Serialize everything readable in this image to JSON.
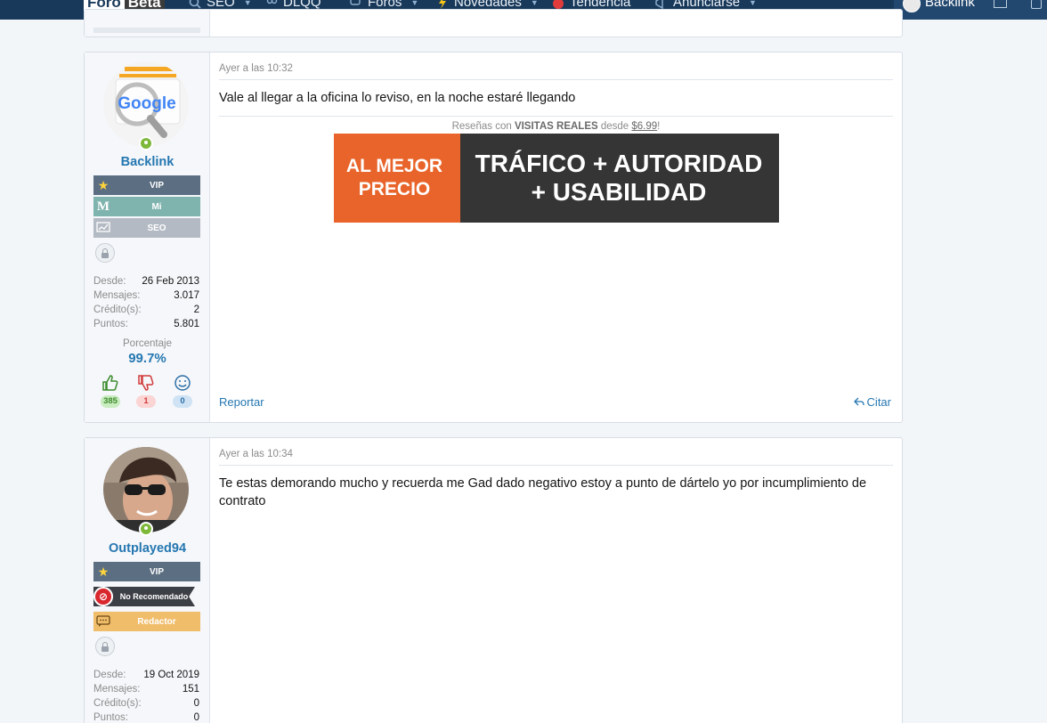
{
  "topbar": {
    "logo_part1": "Foro",
    "logo_part2": "Beta",
    "nav": [
      "SEO",
      "DLQQ",
      "Foros",
      "Novedades",
      "Tendencia",
      "Anunciarse"
    ],
    "user": "Backlink"
  },
  "posts": [
    {
      "date": "Ayer a las 10:32",
      "user": {
        "name": "Backlink",
        "avatar_text": "Google",
        "badges": [
          {
            "icon": "star-icon",
            "label": "VIP"
          },
          {
            "icon": "m-letter-icon",
            "glyph": "M",
            "label": "Mi"
          },
          {
            "icon": "chart-icon",
            "label": "SEO"
          }
        ],
        "stats": [
          {
            "key": "Desde:",
            "value": "26 Feb 2013"
          },
          {
            "key": "Mensajes:",
            "value": "3.017"
          },
          {
            "key": "Crédito(s):",
            "value": "2"
          },
          {
            "key": "Puntos:",
            "value": "5.801"
          }
        ],
        "percent_label": "Porcentaje",
        "percent_value": "99.7%",
        "reactions": {
          "like": "385",
          "dislike": "1",
          "neutral": "0"
        }
      },
      "message": "Vale al llegar a la oficina lo reviso, en la noche estaré llegando",
      "ad": {
        "caption_pre": "Reseñas con ",
        "caption_bold": "VISITAS REALES",
        "caption_mid": " desde ",
        "caption_price": "$6.99",
        "caption_post": "!",
        "left_line1": "AL MEJOR",
        "left_line2": "PRECIO",
        "right_line1": "TRÁFICO + AUTORIDAD",
        "right_line2": "+ USABILIDAD"
      },
      "report": "Reportar",
      "quote": "Citar"
    },
    {
      "date": "Ayer a las 10:34",
      "user": {
        "name": "Outplayed94",
        "badges": [
          {
            "icon": "star-icon",
            "label": "VIP"
          },
          {
            "icon": "no-entry-icon",
            "label": "No Recomendado"
          },
          {
            "icon": "chat-icon",
            "label": "Redactor"
          }
        ],
        "stats": [
          {
            "key": "Desde:",
            "value": "19 Oct 2019"
          },
          {
            "key": "Mensajes:",
            "value": "151"
          },
          {
            "key": "Crédito(s):",
            "value": "0"
          },
          {
            "key": "Puntos:",
            "value": "0"
          }
        ]
      },
      "message": "Te estas demorando mucho y recuerda me Gad dado negativo estoy a punto de dártelo yo por incumplimiento de contrato"
    }
  ],
  "colors": {
    "accent": "#2577b1",
    "navbar": "#19395a",
    "ad_orange": "#e8642a",
    "ad_dark": "#353535"
  }
}
